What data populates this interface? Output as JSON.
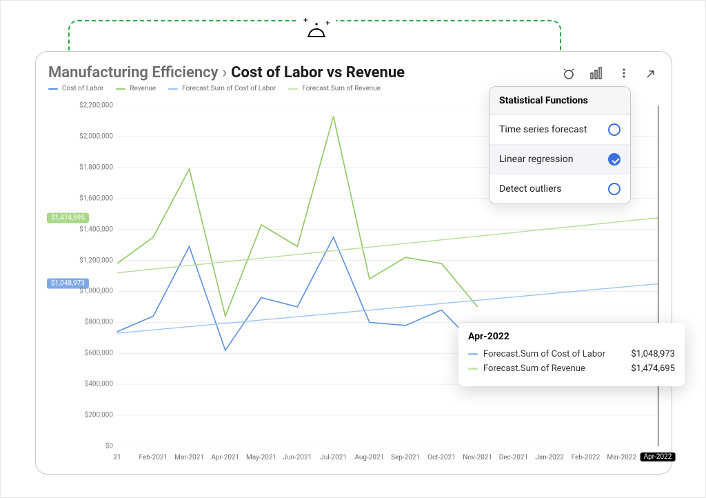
{
  "breadcrumb": {
    "root": "Manufacturing Efficiency",
    "sep": "›",
    "current": "Cost of Labor vs Revenue"
  },
  "legend": [
    {
      "label": "Cost of Labor",
      "color": "#5b8fe0"
    },
    {
      "label": "Revenue",
      "color": "#9bd06a"
    },
    {
      "label": "Forecast.Sum of Cost of Labor",
      "color": "#9cc4f2"
    },
    {
      "label": "Forecast.Sum of Revenue",
      "color": "#c5e4a8"
    }
  ],
  "toolbar_icons": {
    "forecast": "forecast-icon",
    "chart": "bar-chart-icon",
    "menu": "kebab-menu-icon",
    "collapse": "collapse-icon"
  },
  "popover": {
    "title": "Statistical Functions",
    "options": [
      {
        "label": "Time series forecast",
        "selected": false
      },
      {
        "label": "Linear regression",
        "selected": true
      },
      {
        "label": "Detect outliers",
        "selected": false
      }
    ]
  },
  "tooltip": {
    "title": "Apr-2022",
    "rows": [
      {
        "label": "Forecast.Sum of Cost of Labor",
        "value": "$1,048,973",
        "color": "#9cc4f2"
      },
      {
        "label": "Forecast.Sum of Revenue",
        "value": "$1,474,695",
        "color": "#c5e4a8"
      }
    ]
  },
  "regression_badges": {
    "revenue": "$1,474,695",
    "labor": "$1,048,973"
  },
  "colors": {
    "labor": "#5b8fe0",
    "revenue": "#8ec760",
    "labor_reg": "#9cc4f2",
    "revenue_reg": "#b8db9a"
  },
  "chart_data": {
    "type": "line",
    "title": "Cost of Labor vs Revenue",
    "xlabel": "",
    "ylabel": "",
    "ylim": [
      0,
      2200000
    ],
    "yticks": [
      0,
      200000,
      400000,
      600000,
      800000,
      1000000,
      1200000,
      1400000,
      1600000,
      1800000,
      2000000,
      2200000
    ],
    "ytick_labels": [
      "$0",
      "$200,000",
      "$400,000",
      "$600,000",
      "$800,000",
      "$1,000,000",
      "$1,200,000",
      "$1,400,000",
      "$1,600,000",
      "$1,800,000",
      "$2,000,000",
      "$2,200,000"
    ],
    "categories": [
      "21",
      "Feb-2021",
      "Mar-2021",
      "Apr-2021",
      "May-2021",
      "Jun-2021",
      "Jul-2021",
      "Aug-2021",
      "Sep-2021",
      "Oct-2021",
      "Nov-2021",
      "Dec-2021",
      "Jan-2022",
      "Feb-2022",
      "Mar-2022",
      "Apr-2022"
    ],
    "highlight_x": "Apr-2022",
    "series": [
      {
        "name": "Cost of Labor",
        "values": [
          740000,
          840000,
          1290000,
          620000,
          960000,
          900000,
          1350000,
          800000,
          780000,
          880000,
          640000,
          null,
          null,
          null,
          null,
          null
        ]
      },
      {
        "name": "Revenue",
        "values": [
          1180000,
          1350000,
          1790000,
          840000,
          1430000,
          1290000,
          2130000,
          1080000,
          1220000,
          1180000,
          900000,
          null,
          null,
          null,
          null,
          null
        ]
      }
    ],
    "regression": [
      {
        "name": "Forecast.Sum of Cost of Labor",
        "start": 730000,
        "end": 1048973
      },
      {
        "name": "Forecast.Sum of Revenue",
        "start": 1120000,
        "end": 1474695
      }
    ]
  }
}
